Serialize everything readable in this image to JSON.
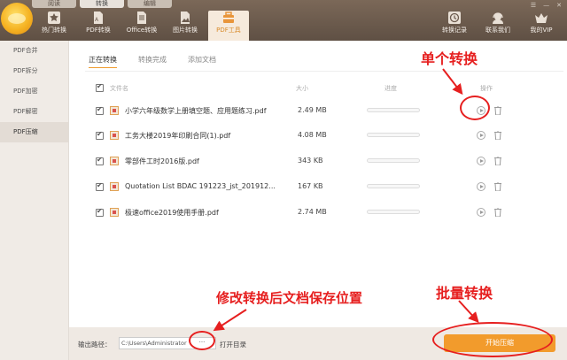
{
  "top_tabs": [
    "阅读",
    "转换",
    "编辑"
  ],
  "nav": {
    "left": [
      {
        "label": "热门转换",
        "icon": "star-icon"
      },
      {
        "label": "PDF转换",
        "icon": "pdf-file-icon"
      },
      {
        "label": "Office转换",
        "icon": "office-file-icon"
      },
      {
        "label": "图片转换",
        "icon": "image-file-icon"
      },
      {
        "label": "PDF工具",
        "icon": "toolbox-icon"
      }
    ],
    "right": [
      {
        "label": "转换记录",
        "icon": "clock-icon"
      },
      {
        "label": "联系我们",
        "icon": "headset-icon"
      },
      {
        "label": "我的VIP",
        "icon": "crown-icon"
      }
    ]
  },
  "sidebar": {
    "items": [
      "PDF合并",
      "PDF拆分",
      "PDF加密",
      "PDF解密",
      "PDF压缩"
    ]
  },
  "subtabs": [
    "正在转换",
    "转换完成",
    "添加文档"
  ],
  "table": {
    "headers": {
      "name": "文件名",
      "size": "大小",
      "progress": "进度",
      "action": "操作"
    },
    "rows": [
      {
        "name": "小学六年级数学上册填空题、应用题练习.pdf",
        "size": "2.49 MB"
      },
      {
        "name": "工务大楼2019年印刷合同(1).pdf",
        "size": "4.08 MB"
      },
      {
        "name": "零部件工时2016版.pdf",
        "size": "343 KB"
      },
      {
        "name": "Quotation List BDAC 191223_jst_201912...",
        "size": "167 KB"
      },
      {
        "name": "极速office2019使用手册.pdf",
        "size": "2.74 MB"
      }
    ]
  },
  "bottom": {
    "output_label": "输出路径：",
    "path": "C:\\Users\\Administrator",
    "dots": "···",
    "open_dir": "打开目录",
    "start_button": "开始压缩"
  },
  "annotations": {
    "single": "单个转换",
    "modify": "修改转换后文档保存位置",
    "batch": "批量转换"
  },
  "colors": {
    "accent": "#f29b2c",
    "annotation": "#e61f1f",
    "topbar": "#6c5b4e"
  }
}
